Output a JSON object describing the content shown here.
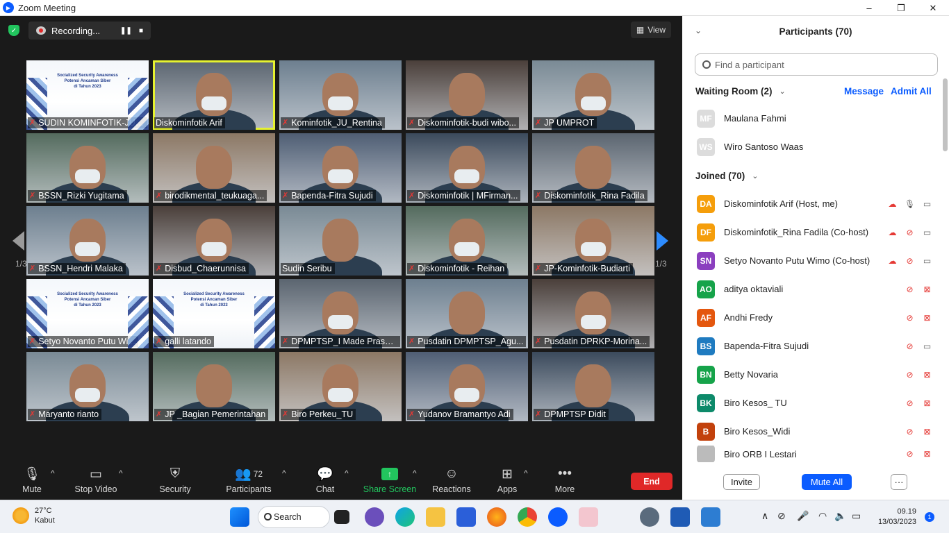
{
  "window": {
    "title": "Zoom Meeting",
    "minimize": "‒",
    "maximize": "❐",
    "close": "✕"
  },
  "meeting": {
    "recording_label": "Recording...",
    "view_label": "View",
    "page_left": "1/3",
    "page_right": "1/3",
    "slide_text": "Socialized Security Awareness\nPotensi Ancaman Siber\ndi Tahun 2023",
    "tiles": [
      {
        "name": "SUDIN KOMINFOTIK-JU_...",
        "type": "slide",
        "muted": true
      },
      {
        "name": "Diskominfotik Arif",
        "type": "person",
        "muted": false,
        "active": true
      },
      {
        "name": "Kominfotik_JU_Rentina",
        "type": "person",
        "muted": true
      },
      {
        "name": "Diskominfotik-budi wibo...",
        "type": "person",
        "muted": true
      },
      {
        "name": "JP UMPROT",
        "type": "person",
        "muted": true
      },
      {
        "name": "BSSN_Rizki Yugitama",
        "type": "person",
        "muted": true
      },
      {
        "name": "birodikmental_teukuaga...",
        "type": "person",
        "muted": true
      },
      {
        "name": "Bapenda-Fitra Sujudi",
        "type": "person",
        "muted": true
      },
      {
        "name": "Diskominfotik | MFirman...",
        "type": "person",
        "muted": true
      },
      {
        "name": "Diskominfotik_Rina Fadila",
        "type": "person",
        "muted": true
      },
      {
        "name": "BSSN_Hendri Malaka",
        "type": "person",
        "muted": true
      },
      {
        "name": "Disbud_Chaerunnisa",
        "type": "person",
        "muted": true
      },
      {
        "name": "Sudin Seribu",
        "type": "person",
        "muted": false
      },
      {
        "name": "Diskominfotik - Reihan",
        "type": "person",
        "muted": true
      },
      {
        "name": "JP-Kominfotik-Budiarti",
        "type": "person",
        "muted": true
      },
      {
        "name": "Setyo Novanto Putu Wi...",
        "type": "slide",
        "muted": true
      },
      {
        "name": "galli latando",
        "type": "slide",
        "muted": true
      },
      {
        "name": "DPMPTSP_I Made Prasat...",
        "type": "person",
        "muted": true
      },
      {
        "name": "Pusdatin DPMPTSP_Agu...",
        "type": "person",
        "muted": true
      },
      {
        "name": "Pusdatin DPRKP-Morina...",
        "type": "person",
        "muted": true
      },
      {
        "name": "Maryanto rianto",
        "type": "person",
        "muted": true
      },
      {
        "name": "JP _Bagian Pemerintahan",
        "type": "person",
        "muted": true
      },
      {
        "name": "Biro Perkeu_TU",
        "type": "person",
        "muted": true
      },
      {
        "name": "Yudanov Bramantyo Adi",
        "type": "person",
        "muted": true
      },
      {
        "name": "DPMPTSP Didit",
        "type": "person",
        "muted": true
      }
    ]
  },
  "toolbar": {
    "mute": "Mute",
    "stop_video": "Stop Video",
    "security": "Security",
    "participants": "Participants",
    "participants_count": "72",
    "chat": "Chat",
    "share_screen": "Share Screen",
    "reactions": "Reactions",
    "apps": "Apps",
    "more": "More",
    "end": "End"
  },
  "panel": {
    "title": "Participants (70)",
    "search_placeholder": "Find a participant",
    "waiting_room": "Waiting Room (2)",
    "message": "Message",
    "admit_all": "Admit All",
    "joined": "Joined (70)",
    "waiting": [
      {
        "initials": "MF",
        "name": "Maulana Fahmi"
      },
      {
        "initials": "WS",
        "name": "Wiro Santoso Waas"
      }
    ],
    "participants": [
      {
        "initials": "DA",
        "name": "Diskominfotik Arif (Host, me)",
        "color": "#f59e0b",
        "rec": true,
        "mic_on": true,
        "cam_on": true
      },
      {
        "initials": "DF",
        "name": "Diskominfotik_Rina Fadila (Co-host)",
        "color": "#f59e0b",
        "rec": true,
        "mic_on": false,
        "cam_on": true
      },
      {
        "initials": "SN",
        "name": "Setyo Novanto Putu Wimo (Co-host)",
        "color": "#8b3fbf",
        "rec": true,
        "mic_on": false,
        "cam_on": true
      },
      {
        "initials": "AO",
        "name": "aditya oktaviali",
        "color": "#16a34a",
        "rec": false,
        "mic_on": false,
        "cam_on": false
      },
      {
        "initials": "AF",
        "name": "Andhi Fredy",
        "color": "#e4570e",
        "rec": false,
        "mic_on": false,
        "cam_on": false
      },
      {
        "initials": "BS",
        "name": "Bapenda-Fitra Sujudi",
        "color": "#1f7bc0",
        "rec": false,
        "mic_on": false,
        "cam_on": true
      },
      {
        "initials": "BN",
        "name": "Betty Novaria",
        "color": "#16a34a",
        "rec": false,
        "mic_on": false,
        "cam_on": false
      },
      {
        "initials": "BK",
        "name": "Biro Kesos_ TU",
        "color": "#0d8a6a",
        "rec": false,
        "mic_on": false,
        "cam_on": false
      },
      {
        "initials": "B",
        "name": "Biro Kesos_Widi",
        "color": "#c2410c",
        "rec": false,
        "mic_on": false,
        "cam_on": false
      },
      {
        "initials": "",
        "name": "Biro ORB I Lestari",
        "color": "#bbbbbb",
        "rec": false,
        "mic_on": false,
        "cam_on": false
      }
    ],
    "invite": "Invite",
    "mute_all": "Mute All",
    "more": "···"
  },
  "taskbar": {
    "temperature": "27°C",
    "weather": "Kabut",
    "search": "Search",
    "time": "09.19",
    "date": "13/03/2023",
    "notifications": "1"
  }
}
